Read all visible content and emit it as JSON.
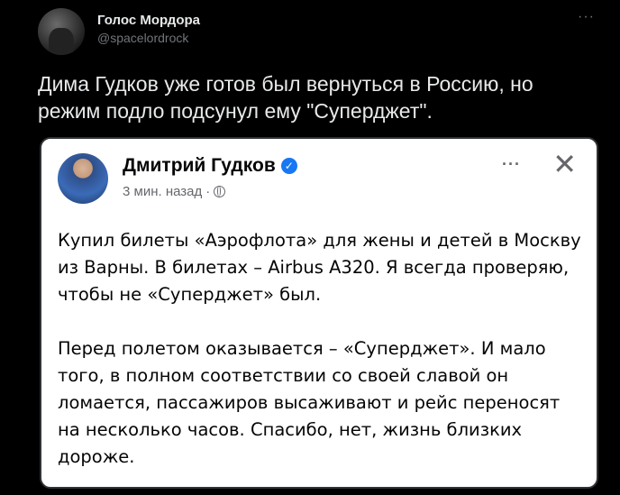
{
  "tweet": {
    "author_name": "Голос Мордора",
    "author_handle": "@spacelordrock",
    "more_label": "···",
    "text": "Дима Гудков уже готов был вернуться в Россию, но режим подло подсунул ему \"Суперджет\"."
  },
  "embed": {
    "author_name": "Дмитрий Гудков",
    "verified_glyph": "✓",
    "time": "3 мин. назад",
    "separator": "·",
    "more_label": "···",
    "close_label": "✕",
    "paragraphs": [
      "Купил билеты «Аэрофлота» для жены и детей в Москву из Варны. В билетах – Airbus A320. Я всегда проверяю, чтобы не «Суперджет» был.",
      "Перед полетом оказывается – «Суперджет». И мало того, в полном соответствии со своей славой он ломается, пассажиров высаживают и рейс переносят на несколько часов. Спасибо, нет, жизнь близких дороже."
    ],
    "icons": {
      "verified": "verified-badge-icon",
      "privacy": "globe-icon"
    }
  },
  "colors": {
    "background": "#000000",
    "text": "#e7e9ea",
    "muted": "#71767b",
    "card": "#ffffff",
    "verified": "#1877f2"
  }
}
